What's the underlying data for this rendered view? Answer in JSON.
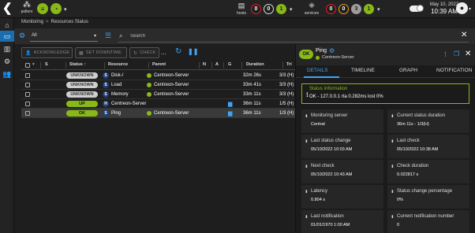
{
  "header": {
    "pollers_label": "pollers",
    "hosts_label": "hosts",
    "services_label": "services",
    "host_counts": [
      "0",
      "0",
      "1"
    ],
    "service_counts": [
      "0",
      "0",
      "3",
      "1"
    ],
    "date": "May 10, 2022",
    "time": "10:39 AM"
  },
  "breadcrumb": {
    "root": "Monitoring",
    "separator": ">",
    "page": "Resources Status"
  },
  "filter": {
    "selected": "All",
    "search_placeholder": "Search"
  },
  "actions": {
    "acknowledge": "ACKNOWLEDGE",
    "set_downtime": "SET DOWNTIME",
    "check": "CHECK",
    "more": "..."
  },
  "table": {
    "columns": {
      "s": "S",
      "status": "Status",
      "resource": "Resource",
      "parent": "Parent",
      "n": "N",
      "a": "A",
      "g": "G",
      "duration": "Duration",
      "tries": "Tri"
    },
    "rows": [
      {
        "status": "UNKNOWN",
        "type": "S",
        "resource": "Disk-/",
        "parent": "Centreon-Server",
        "duration": "32m 26s",
        "tries": "3/3 (H)"
      },
      {
        "status": "UNKNOWN",
        "type": "S",
        "resource": "Load",
        "parent": "Centreon-Server",
        "duration": "33m 41s",
        "tries": "3/3 (H)"
      },
      {
        "status": "UNKNOWN",
        "type": "S",
        "resource": "Memory",
        "parent": "Centreon-Server",
        "duration": "33m 11s",
        "tries": "3/3 (H)"
      },
      {
        "status": "UP",
        "type": "H",
        "resource": "Centreon-Server",
        "parent": "",
        "duration": "36m 11s",
        "tries": "1/5 (H)"
      },
      {
        "status": "OK",
        "type": "S",
        "resource": "Ping",
        "parent": "Centreon-Server",
        "duration": "36m 11s",
        "tries": "1/3 (H)"
      }
    ]
  },
  "panel": {
    "badge": "OK",
    "title": "Ping",
    "host": "Centreon-Server",
    "tabs": [
      "DETAILS",
      "TIMELINE",
      "GRAPH",
      "NOTIFICATION"
    ],
    "status_info_title": "Status information",
    "status_info_value": "OK - 127.0.0.1 rta 0.282ms lost 0%",
    "cards": [
      {
        "title": "Monitoring server",
        "value": "Central"
      },
      {
        "title": "Current status duration",
        "value": "36m 11s - 1/3(H)"
      },
      {
        "title": "Last status change",
        "value": "05/10/2022 10:03 AM"
      },
      {
        "title": "Last check",
        "value": "05/10/2022 10:38 AM"
      },
      {
        "title": "Next check",
        "value": "05/10/2022 10:43 AM"
      },
      {
        "title": "Check duration",
        "value": "0.022817 s"
      },
      {
        "title": "Latency",
        "value": "0.804 s"
      },
      {
        "title": "Status change percentage",
        "value": "0%"
      },
      {
        "title": "Last notification",
        "value": "01/01/1970 1:00 AM"
      },
      {
        "title": "Current notification number",
        "value": "0"
      }
    ]
  },
  "colors": {
    "ok_green": "#88b917",
    "accent_blue": "#3fa4f4",
    "critical_red": "#ed1c24",
    "unknown_grey": "#cfcfcf"
  }
}
